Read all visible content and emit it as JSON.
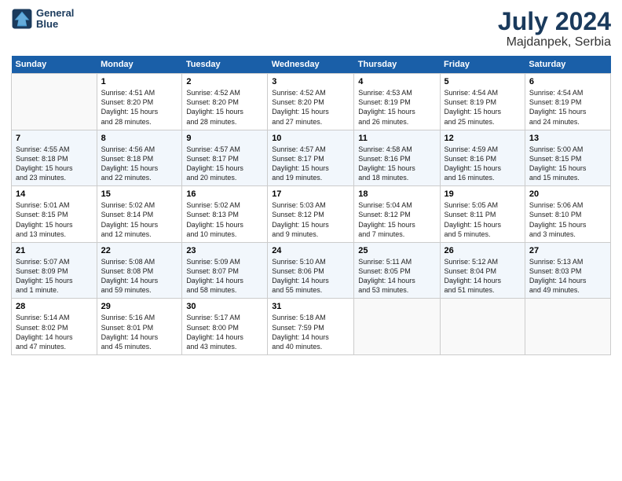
{
  "logo": {
    "line1": "General",
    "line2": "Blue"
  },
  "title": {
    "main": "July 2024",
    "sub": "Majdanpek, Serbia"
  },
  "weekdays": [
    "Sunday",
    "Monday",
    "Tuesday",
    "Wednesday",
    "Thursday",
    "Friday",
    "Saturday"
  ],
  "weeks": [
    [
      {
        "day": "",
        "text": ""
      },
      {
        "day": "1",
        "text": "Sunrise: 4:51 AM\nSunset: 8:20 PM\nDaylight: 15 hours\nand 28 minutes."
      },
      {
        "day": "2",
        "text": "Sunrise: 4:52 AM\nSunset: 8:20 PM\nDaylight: 15 hours\nand 28 minutes."
      },
      {
        "day": "3",
        "text": "Sunrise: 4:52 AM\nSunset: 8:20 PM\nDaylight: 15 hours\nand 27 minutes."
      },
      {
        "day": "4",
        "text": "Sunrise: 4:53 AM\nSunset: 8:19 PM\nDaylight: 15 hours\nand 26 minutes."
      },
      {
        "day": "5",
        "text": "Sunrise: 4:54 AM\nSunset: 8:19 PM\nDaylight: 15 hours\nand 25 minutes."
      },
      {
        "day": "6",
        "text": "Sunrise: 4:54 AM\nSunset: 8:19 PM\nDaylight: 15 hours\nand 24 minutes."
      }
    ],
    [
      {
        "day": "7",
        "text": "Sunrise: 4:55 AM\nSunset: 8:18 PM\nDaylight: 15 hours\nand 23 minutes."
      },
      {
        "day": "8",
        "text": "Sunrise: 4:56 AM\nSunset: 8:18 PM\nDaylight: 15 hours\nand 22 minutes."
      },
      {
        "day": "9",
        "text": "Sunrise: 4:57 AM\nSunset: 8:17 PM\nDaylight: 15 hours\nand 20 minutes."
      },
      {
        "day": "10",
        "text": "Sunrise: 4:57 AM\nSunset: 8:17 PM\nDaylight: 15 hours\nand 19 minutes."
      },
      {
        "day": "11",
        "text": "Sunrise: 4:58 AM\nSunset: 8:16 PM\nDaylight: 15 hours\nand 18 minutes."
      },
      {
        "day": "12",
        "text": "Sunrise: 4:59 AM\nSunset: 8:16 PM\nDaylight: 15 hours\nand 16 minutes."
      },
      {
        "day": "13",
        "text": "Sunrise: 5:00 AM\nSunset: 8:15 PM\nDaylight: 15 hours\nand 15 minutes."
      }
    ],
    [
      {
        "day": "14",
        "text": "Sunrise: 5:01 AM\nSunset: 8:15 PM\nDaylight: 15 hours\nand 13 minutes."
      },
      {
        "day": "15",
        "text": "Sunrise: 5:02 AM\nSunset: 8:14 PM\nDaylight: 15 hours\nand 12 minutes."
      },
      {
        "day": "16",
        "text": "Sunrise: 5:02 AM\nSunset: 8:13 PM\nDaylight: 15 hours\nand 10 minutes."
      },
      {
        "day": "17",
        "text": "Sunrise: 5:03 AM\nSunset: 8:12 PM\nDaylight: 15 hours\nand 9 minutes."
      },
      {
        "day": "18",
        "text": "Sunrise: 5:04 AM\nSunset: 8:12 PM\nDaylight: 15 hours\nand 7 minutes."
      },
      {
        "day": "19",
        "text": "Sunrise: 5:05 AM\nSunset: 8:11 PM\nDaylight: 15 hours\nand 5 minutes."
      },
      {
        "day": "20",
        "text": "Sunrise: 5:06 AM\nSunset: 8:10 PM\nDaylight: 15 hours\nand 3 minutes."
      }
    ],
    [
      {
        "day": "21",
        "text": "Sunrise: 5:07 AM\nSunset: 8:09 PM\nDaylight: 15 hours\nand 1 minute."
      },
      {
        "day": "22",
        "text": "Sunrise: 5:08 AM\nSunset: 8:08 PM\nDaylight: 14 hours\nand 59 minutes."
      },
      {
        "day": "23",
        "text": "Sunrise: 5:09 AM\nSunset: 8:07 PM\nDaylight: 14 hours\nand 58 minutes."
      },
      {
        "day": "24",
        "text": "Sunrise: 5:10 AM\nSunset: 8:06 PM\nDaylight: 14 hours\nand 55 minutes."
      },
      {
        "day": "25",
        "text": "Sunrise: 5:11 AM\nSunset: 8:05 PM\nDaylight: 14 hours\nand 53 minutes."
      },
      {
        "day": "26",
        "text": "Sunrise: 5:12 AM\nSunset: 8:04 PM\nDaylight: 14 hours\nand 51 minutes."
      },
      {
        "day": "27",
        "text": "Sunrise: 5:13 AM\nSunset: 8:03 PM\nDaylight: 14 hours\nand 49 minutes."
      }
    ],
    [
      {
        "day": "28",
        "text": "Sunrise: 5:14 AM\nSunset: 8:02 PM\nDaylight: 14 hours\nand 47 minutes."
      },
      {
        "day": "29",
        "text": "Sunrise: 5:16 AM\nSunset: 8:01 PM\nDaylight: 14 hours\nand 45 minutes."
      },
      {
        "day": "30",
        "text": "Sunrise: 5:17 AM\nSunset: 8:00 PM\nDaylight: 14 hours\nand 43 minutes."
      },
      {
        "day": "31",
        "text": "Sunrise: 5:18 AM\nSunset: 7:59 PM\nDaylight: 14 hours\nand 40 minutes."
      },
      {
        "day": "",
        "text": ""
      },
      {
        "day": "",
        "text": ""
      },
      {
        "day": "",
        "text": ""
      }
    ]
  ]
}
